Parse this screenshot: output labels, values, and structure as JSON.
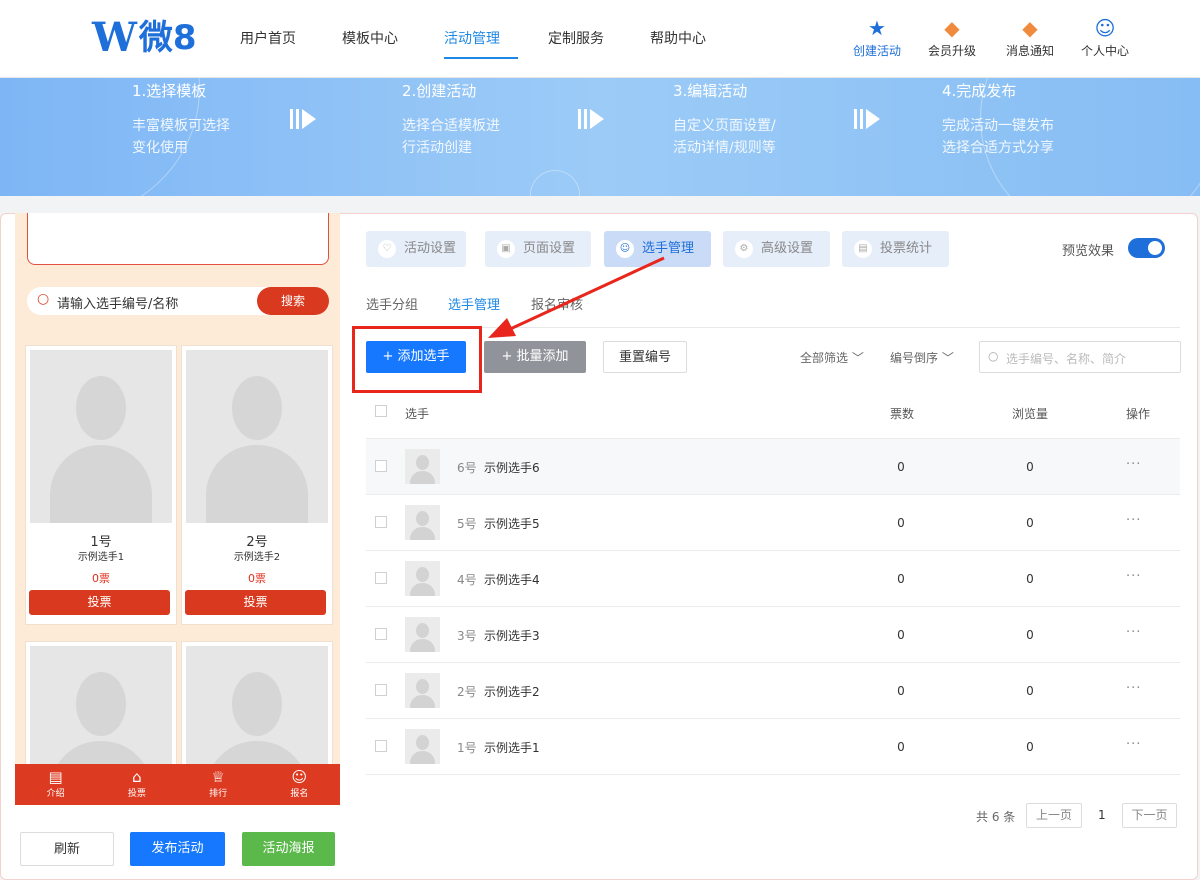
{
  "header": {
    "logo_text": "微8",
    "nav": [
      "用户首页",
      "模板中心",
      "活动管理",
      "定制服务",
      "帮助中心"
    ],
    "active_nav": "活动管理",
    "tools": [
      "创建活动",
      "会员升级",
      "消息通知",
      "个人中心"
    ]
  },
  "banner": {
    "steps": [
      {
        "title": "1.选择模板",
        "line1": "丰富模板可选择",
        "line2": "变化使用"
      },
      {
        "title": "2.创建活动",
        "line1": "选择合适模板进",
        "line2": "行活动创建"
      },
      {
        "title": "3.编辑活动",
        "line1": "自定义页面设置/",
        "line2": "活动详情/规则等"
      },
      {
        "title": "4.完成发布",
        "line1": "完成活动一键发布",
        "line2": "选择合适方式分享"
      }
    ]
  },
  "phone": {
    "search_placeholder": "请输入选手编号/名称",
    "search_button": "搜索",
    "cards": [
      {
        "num": "1号",
        "name": "示例选手1",
        "votes": "0票",
        "vote_btn": "投票"
      },
      {
        "num": "2号",
        "name": "示例选手2",
        "votes": "0票",
        "vote_btn": "投票"
      }
    ],
    "tabbar": [
      "介绍",
      "投票",
      "排行",
      "报名"
    ]
  },
  "bottom_buttons": {
    "refresh": "刷新",
    "publish": "发布活动",
    "poster": "活动海报"
  },
  "tabs": [
    "活动设置",
    "页面设置",
    "选手管理",
    "高级设置",
    "投票统计"
  ],
  "active_tab": "选手管理",
  "preview_label": "预览效果",
  "preview_on": true,
  "subtabs": [
    "选手分组",
    "选手管理",
    "报名审核"
  ],
  "toolbar": {
    "add": "+ 添加选手",
    "batch": "+ 批量添加",
    "renumber": "重置编号",
    "filter_all": "全部筛选",
    "sort": "编号倒序",
    "search_placeholder": "选手编号、名称、简介"
  },
  "table": {
    "headers": {
      "player": "选手",
      "votes": "票数",
      "views": "浏览量",
      "ops": "操作"
    },
    "rows": [
      {
        "num": "6号",
        "name": "示例选手6",
        "votes": "0",
        "views": "0",
        "ops": "···"
      },
      {
        "num": "5号",
        "name": "示例选手5",
        "votes": "0",
        "views": "0",
        "ops": "···"
      },
      {
        "num": "4号",
        "name": "示例选手4",
        "votes": "0",
        "views": "0",
        "ops": "···"
      },
      {
        "num": "3号",
        "name": "示例选手3",
        "votes": "0",
        "views": "0",
        "ops": "···"
      },
      {
        "num": "2号",
        "name": "示例选手2",
        "votes": "0",
        "views": "0",
        "ops": "···"
      },
      {
        "num": "1号",
        "name": "示例选手1",
        "votes": "0",
        "views": "0",
        "ops": "···"
      }
    ]
  },
  "pagination": {
    "total": "共 6 条",
    "prev": "上一页",
    "page": "1",
    "next": "下一页"
  },
  "colors": {
    "brand": "#1e6fd9",
    "accent_red": "#d93a1f",
    "poster_green": "#5ab94a",
    "highlight": "#e8261c"
  }
}
